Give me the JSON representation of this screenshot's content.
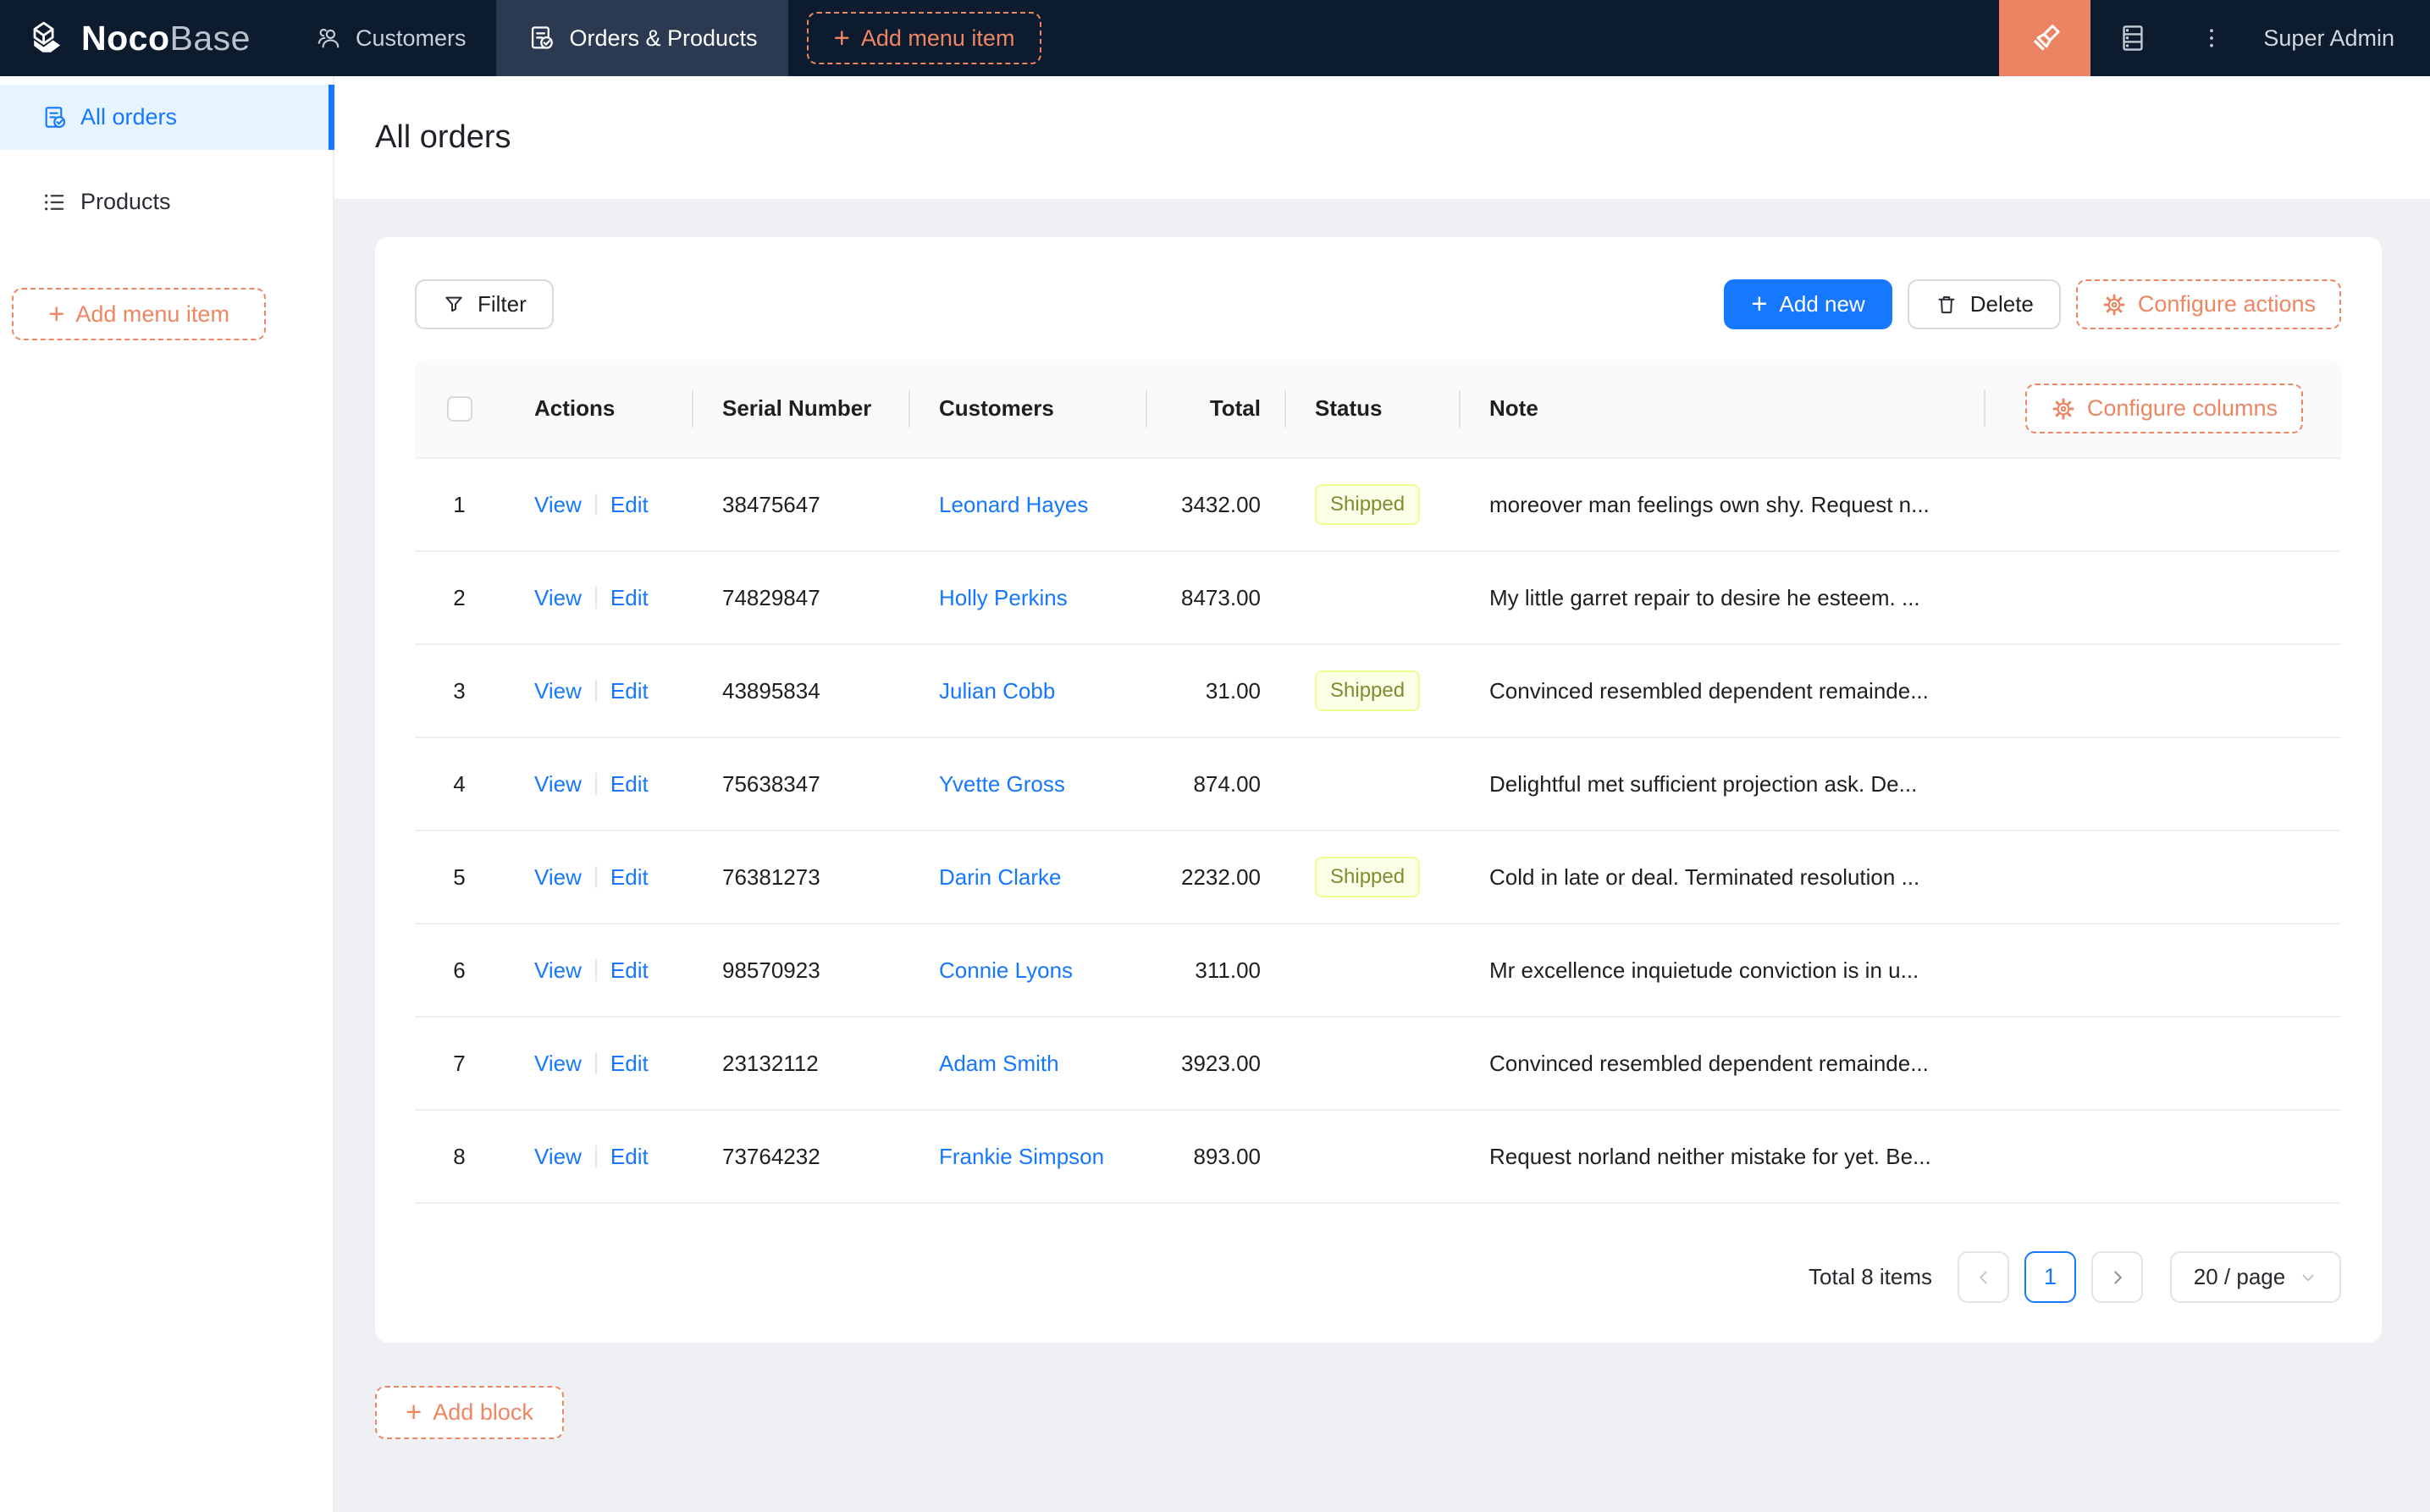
{
  "navbar": {
    "logo_primary": "Noco",
    "logo_secondary": "Base",
    "tabs": [
      {
        "label": "Customers"
      },
      {
        "label": "Orders & Products",
        "active": true
      }
    ],
    "add_menu_item_label": "Add menu item",
    "user": "Super Admin"
  },
  "sidebar": {
    "items": [
      {
        "label": "All orders",
        "active": true
      },
      {
        "label": "Products"
      }
    ],
    "add_menu_item_label": "Add menu item"
  },
  "page": {
    "title": "All orders"
  },
  "toolbar": {
    "filter_label": "Filter",
    "add_new_label": "Add new",
    "delete_label": "Delete",
    "configure_actions_label": "Configure actions"
  },
  "table": {
    "configure_columns_label": "Configure columns",
    "columns": [
      "Actions",
      "Serial Number",
      "Customers",
      "Total",
      "Status",
      "Note"
    ],
    "action_labels": {
      "view": "View",
      "edit": "Edit"
    },
    "rows": [
      {
        "index": "1",
        "serial": "38475647",
        "customer": "Leonard Hayes",
        "total": "3432.00",
        "status": "Shipped",
        "note": "moreover man feelings own shy. Request n..."
      },
      {
        "index": "2",
        "serial": "74829847",
        "customer": "Holly Perkins",
        "total": "8473.00",
        "status": "",
        "note": "My little garret repair to desire he esteem. ..."
      },
      {
        "index": "3",
        "serial": "43895834",
        "customer": "Julian Cobb",
        "total": "31.00",
        "status": "Shipped",
        "note": "Convinced resembled dependent remainde..."
      },
      {
        "index": "4",
        "serial": "75638347",
        "customer": "Yvette Gross",
        "total": "874.00",
        "status": "",
        "note": "Delightful met sufficient projection ask. De..."
      },
      {
        "index": "5",
        "serial": "76381273",
        "customer": "Darin Clarke",
        "total": "2232.00",
        "status": "Shipped",
        "note": "Cold in late or deal. Terminated resolution ..."
      },
      {
        "index": "6",
        "serial": "98570923",
        "customer": "Connie Lyons",
        "total": "311.00",
        "status": "",
        "note": "Mr excellence inquietude conviction is in u..."
      },
      {
        "index": "7",
        "serial": "23132112",
        "customer": "Adam Smith",
        "total": "3923.00",
        "status": "",
        "note": "Convinced resembled dependent remainde..."
      },
      {
        "index": "8",
        "serial": "73764232",
        "customer": "Frankie Simpson",
        "total": "893.00",
        "status": "",
        "note": "Request norland neither mistake for yet. Be..."
      }
    ]
  },
  "pagination": {
    "total_text": "Total 8 items",
    "current_page": "1",
    "page_size": "20 / page"
  },
  "footer": {
    "add_block_label": "Add block"
  },
  "icons": {
    "nocobase-logo": "white isometric cube mark",
    "customers-icon": "two-person team outline",
    "orders-icon": "document with check circle",
    "plus-icon": "+",
    "highlighter-icon": "tilted marker pen (UI editor)",
    "database-icon": "stacked storage rows",
    "ellipsis-vertical-icon": "⋮",
    "all-orders-icon": "document with check circle",
    "products-icon": "bulleted list",
    "filter-icon": "funnel",
    "trash-icon": "trash bin",
    "gear-icon": "settings gear",
    "chevron-left-icon": "‹",
    "chevron-right-icon": "›",
    "chevron-down-icon": "ˇ"
  },
  "colors": {
    "accent_blue": "#1677ff",
    "designer_orange": "#ee8663",
    "navbar_bg": "#0d1b2f",
    "navbar_active_tab": "#2b3a51",
    "sidebar_active_bg": "#e6f4ff",
    "content_bg": "#eef0f3",
    "status_shipped_bg": "#fcffe6",
    "status_shipped_border": "#eaff8f",
    "status_shipped_text": "#7c8d33"
  }
}
